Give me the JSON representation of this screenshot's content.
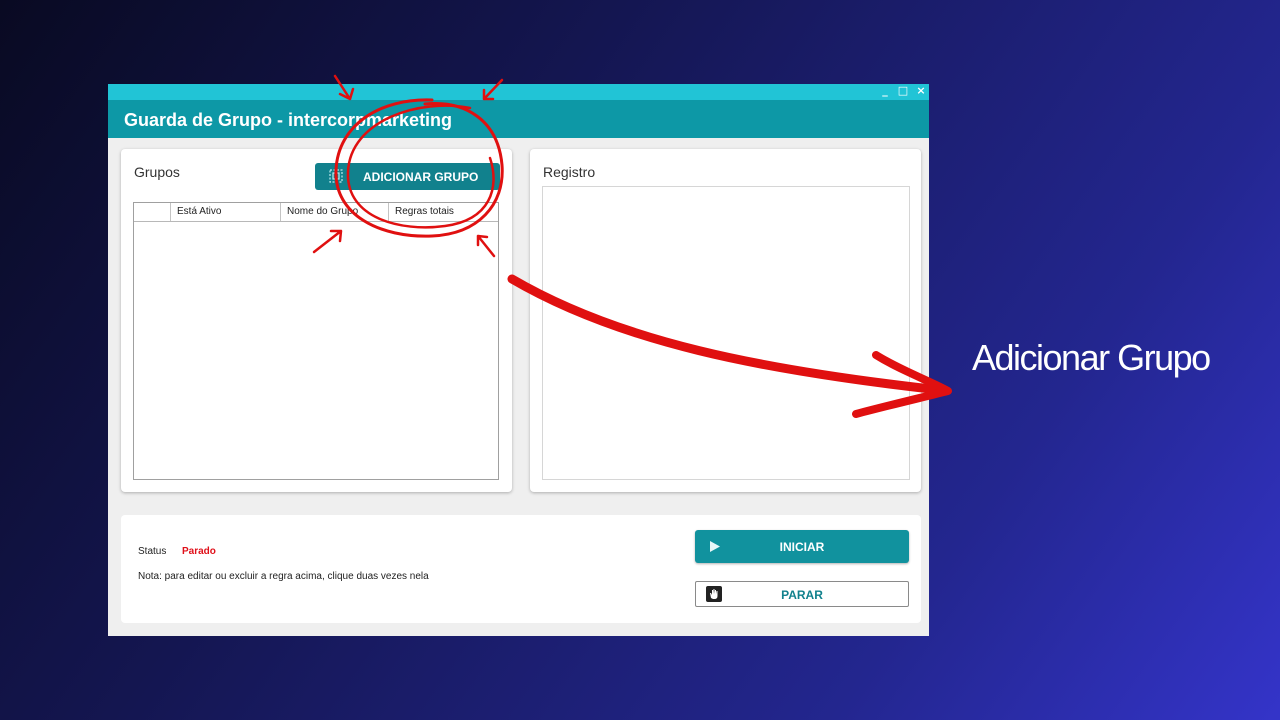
{
  "window": {
    "title": "Guarda de Grupo - intercorpmarketing",
    "controls": {
      "minimize": "_",
      "maximize": "□",
      "close": "×"
    }
  },
  "groups_panel": {
    "title": "Grupos",
    "add_button_label": "ADICIONAR GRUPO",
    "add_button_icon": "add-group-icon",
    "columns": [
      "",
      "Está Ativo",
      "Nome do Grupo",
      "Regras totais"
    ],
    "rows": []
  },
  "log_panel": {
    "title": "Registro"
  },
  "status": {
    "label": "Status",
    "value": "Parado",
    "value_color": "#e0101a",
    "note": "Nota: para editar ou excluir a regra acima, clique duas vezes nela"
  },
  "controls": {
    "start_label": "INICIAR",
    "start_icon": "play-icon",
    "stop_label": "PARAR",
    "stop_icon": "hand-stop-icon"
  },
  "annotation": {
    "callout_text": "Adicionar Grupo",
    "annotation_color": "#e01010"
  },
  "theme": {
    "accent": "#0d98a6",
    "accent_light": "#21c4d6",
    "button_dark": "#11818d"
  }
}
